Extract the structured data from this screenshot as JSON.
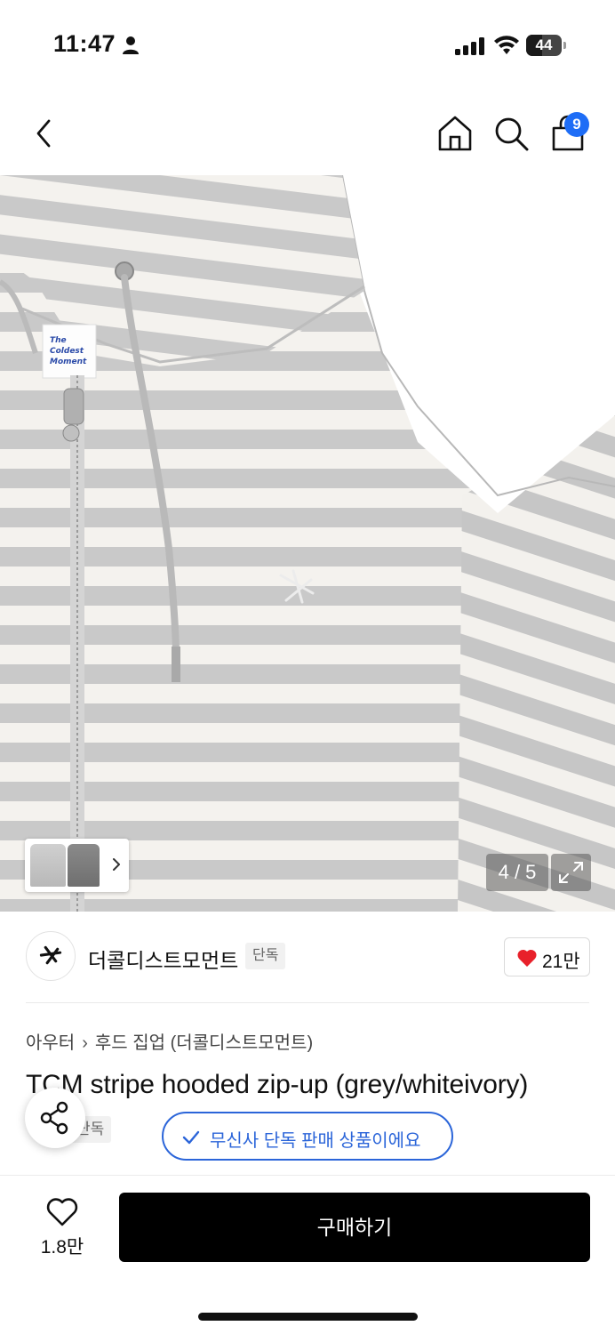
{
  "status_bar": {
    "time": "11:47",
    "battery_level": "44",
    "icons": [
      "person-icon",
      "signal-icon",
      "wifi-icon",
      "battery-icon"
    ]
  },
  "header": {
    "icons": [
      "chevron-left-icon",
      "home-icon",
      "search-icon",
      "shopping-bag-icon"
    ],
    "cart_count": "9"
  },
  "gallery": {
    "counter": "4 / 5",
    "current_page": 4,
    "total_pages": 5,
    "label_text": [
      "The",
      "Coldest",
      "Moment"
    ]
  },
  "brand": {
    "name": "더콜디스트모먼트",
    "tag": "단독",
    "likes": "21만"
  },
  "category": {
    "main": "아우터",
    "sub": "후드 집업 (더콜디스트모먼트)"
  },
  "product": {
    "title": "TCM stripe hooded zip-up (grey/whiteivory)",
    "exclusive_tag": "단독",
    "toast": "무신사 단독 판매 상품이에요"
  },
  "bottom_bar": {
    "wishlist_count": "1.8만",
    "buy_label": "구매하기"
  },
  "colors": {
    "accent_blue": "#2b65d9",
    "badge_blue": "#1e6df6",
    "heart_red": "#e8202a",
    "buy_button": "#000000",
    "stripe_grey": "#c9c9c9",
    "stripe_ivory": "#f4f2ee"
  }
}
